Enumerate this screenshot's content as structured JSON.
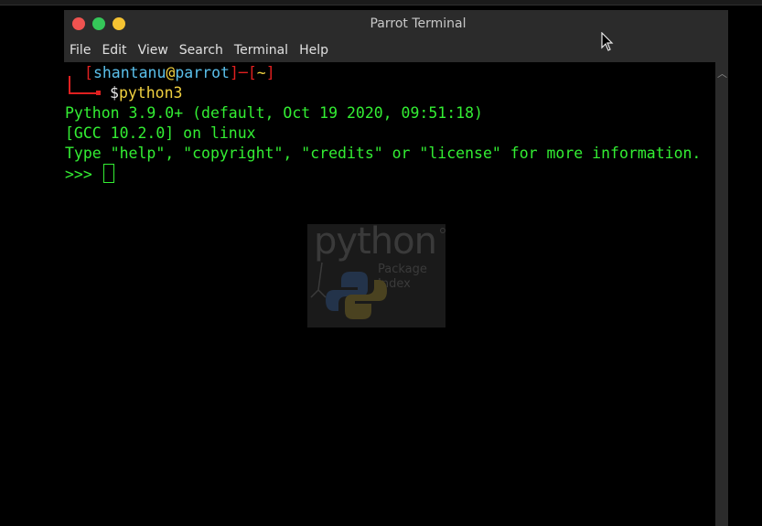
{
  "window": {
    "title": "Parrot Terminal"
  },
  "menu": {
    "items": [
      "File",
      "Edit",
      "View",
      "Search",
      "Terminal",
      "Help"
    ]
  },
  "terminal": {
    "prompt": {
      "open1": "┌─[",
      "user": "shantanu",
      "at": "@",
      "host": "parrot",
      "mid": "]─[",
      "dir": "~",
      "close": "]",
      "dollar": "$",
      "command": "python3"
    },
    "output": [
      "Python 3.9.0+ (default, Oct 19 2020, 09:51:18)",
      "[GCC 10.2.0] on linux",
      "Type \"help\", \"copyright\", \"credits\" or \"license\" for more information."
    ],
    "repl_prompt": ">>> "
  },
  "logo": {
    "word": "python",
    "line1": "Package",
    "line2": "Index"
  },
  "icons": {
    "close": "close-icon",
    "maximize": "maximize-icon",
    "minimize": "minimize-icon",
    "scroll_up": "chevron-up-icon",
    "cursor": "mouse-pointer-icon"
  },
  "colors": {
    "prompt_red": "#e02020",
    "user_cyan": "#5bc0eb",
    "at_yellow": "#f0d040",
    "output_green": "#33ee33",
    "titlebar": "#2b2b2b"
  }
}
